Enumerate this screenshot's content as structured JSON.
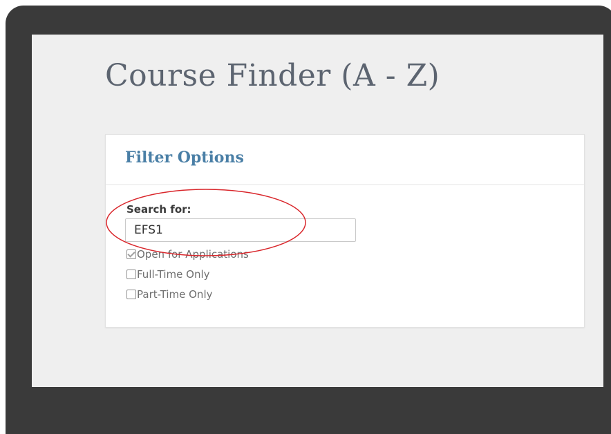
{
  "page": {
    "title": "Course Finder (A - Z)"
  },
  "filter": {
    "header": "Filter Options",
    "search_label": "Search for:",
    "search_value": "EFS1",
    "options": [
      {
        "label": "Open for Applications",
        "checked": true
      },
      {
        "label": "Full-Time Only",
        "checked": false
      },
      {
        "label": "Part-Time Only",
        "checked": false
      }
    ]
  },
  "annotation": {
    "color": "#d9262b"
  },
  "colors": {
    "frame": "#3a3a3a",
    "screen_bg": "#efefef",
    "title": "#5c6470",
    "accent": "#4a7fa6"
  }
}
